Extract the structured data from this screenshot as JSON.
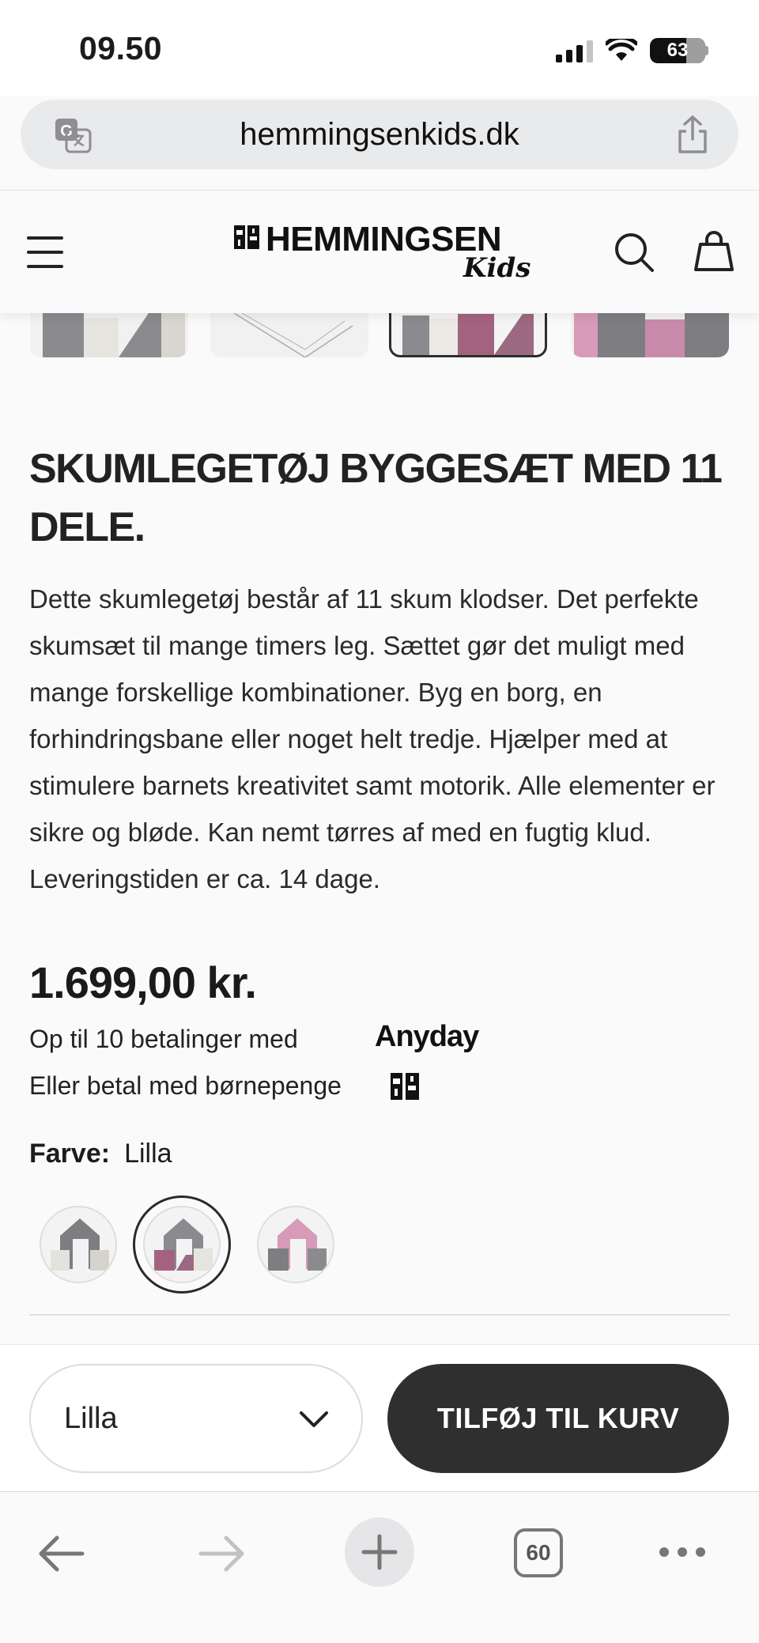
{
  "status_bar": {
    "time": "09.50",
    "battery": "63"
  },
  "browser": {
    "url": "hemmingsenkids.dk",
    "tab_count": "60"
  },
  "header": {
    "logo_title": "HEMMINGSEN",
    "logo_sub": "Kids"
  },
  "product": {
    "title": "SKUMLEGETØJ BYGGESÆT MED 11 DELE.",
    "description": "Dette skumlegetøj består af 11 skum klodser. Det perfekte skumsæt til mange timers leg. Sættet gør det muligt med mange forskellige kombinationer. Byg en borg, en forhindringsbane eller noget helt tredje. Hjælper med at stimulere barnets kreativitet samt motorik. Alle elementer er sikre og bløde. Kan nemt tørres af med en fugtig klud. Leveringstiden er ca. 14 dage.",
    "price": "1.699,00 kr.",
    "installments_text": "Op til 10 betalinger med",
    "installments_brand": "Anyday",
    "child_benefit_text": "Eller betal med børnepenge",
    "color_label": "Farve:",
    "color_value": "Lilla",
    "swatches": [
      "grey",
      "lilla",
      "pink"
    ],
    "selected_swatch": 1
  },
  "buy_bar": {
    "variant_value": "Lilla",
    "add_to_cart": "TILFØJ TIL KURV"
  },
  "colors": {
    "accent_dark": "#2f2f2f",
    "lilla": "#a3637f",
    "grey": "#7d7d82",
    "pink": "#d79ab9"
  }
}
